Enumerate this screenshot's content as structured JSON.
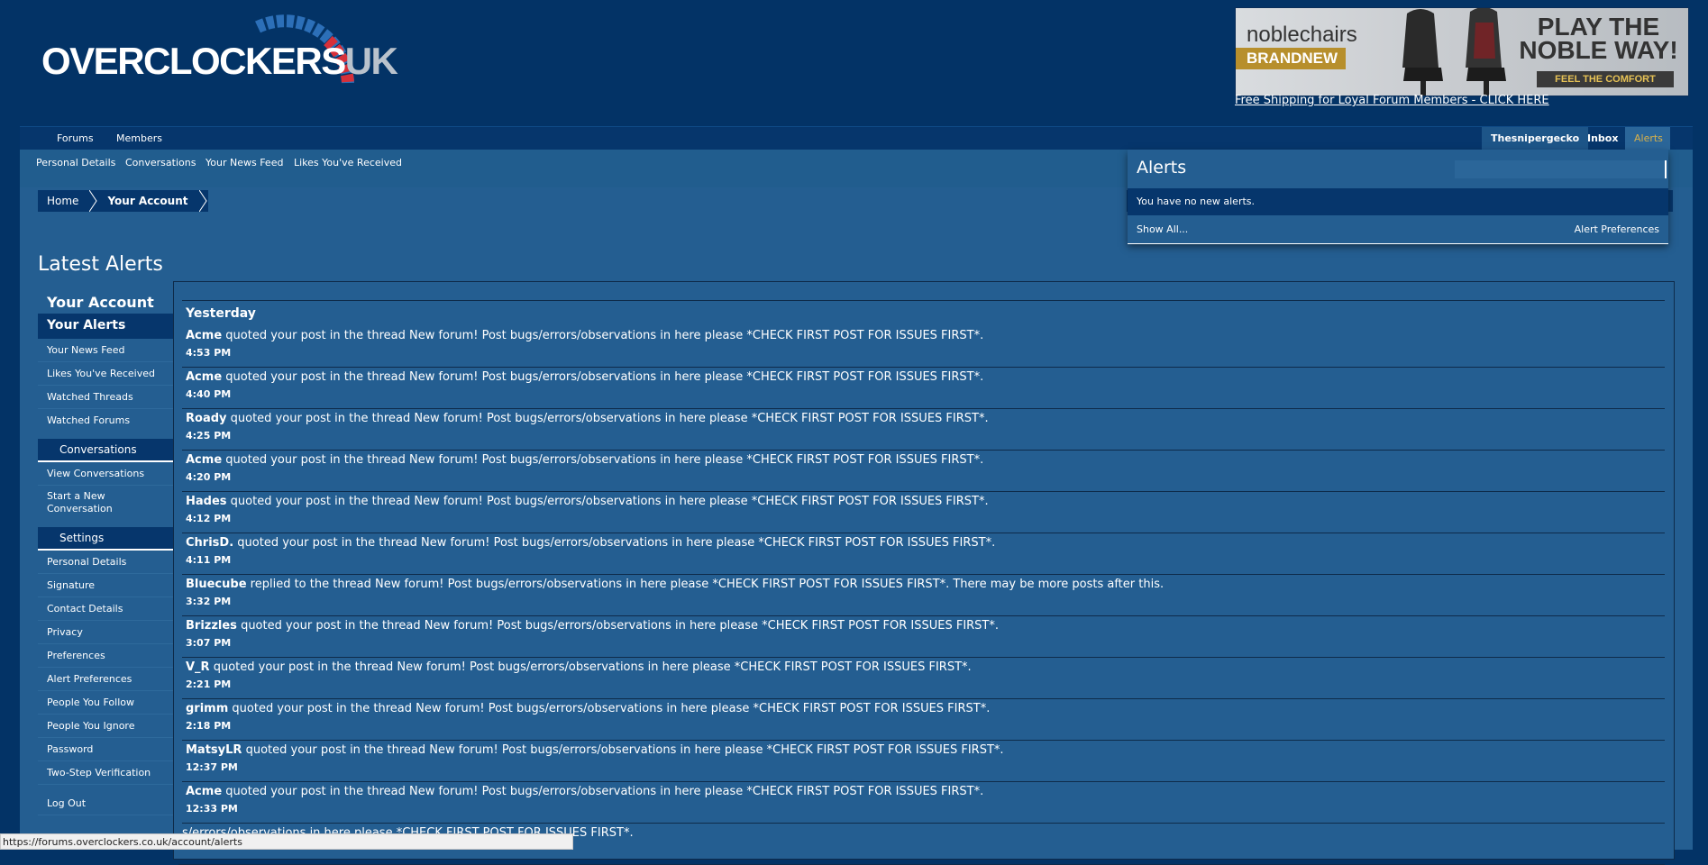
{
  "header": {
    "logo_main": "OVERCLOCKERS",
    "logo_suffix": "UK",
    "banner_brand": "noblechairs",
    "banner_badge": "BRANDNEW",
    "banner_tagline": "PLAY THE NOBLE WAY!",
    "banner_cta": "FEEL THE COMFORT",
    "shipping_link": "Free Shipping for Loyal Forum Members - CLICK HERE"
  },
  "nav": {
    "tabs": [
      "Forums",
      "Members"
    ],
    "username": "Thesnipergecko",
    "inbox": "Inbox",
    "alerts": "Alerts",
    "subnav": [
      "Personal Details",
      "Conversations",
      "Your News Feed",
      "Likes You've Received"
    ]
  },
  "breadcrumb": [
    "Home",
    "Your Account"
  ],
  "page_title": "Latest Alerts",
  "sidebar": {
    "heading": "Your Account",
    "active": "Your Alerts",
    "account_items": [
      "Your News Feed",
      "Likes You've Received",
      "Watched Threads",
      "Watched Forums"
    ],
    "conversations_title": "Conversations",
    "conversation_items": [
      "View Conversations",
      "Start a New Conversation"
    ],
    "settings_title": "Settings",
    "settings_items": [
      "Personal Details",
      "Signature",
      "Contact Details",
      "Privacy",
      "Preferences",
      "Alert Preferences",
      "People You Follow",
      "People You Ignore",
      "Password",
      "Two-Step Verification"
    ],
    "logout": "Log Out"
  },
  "alerts": {
    "day": "Yesterday",
    "items": [
      {
        "user": "Acme",
        "text": "quoted your post in the thread New forum! Post bugs/errors/observations in here please *CHECK FIRST POST FOR ISSUES FIRST*.",
        "time": "4:53 PM"
      },
      {
        "user": "Acme",
        "text": "quoted your post in the thread New forum! Post bugs/errors/observations in here please *CHECK FIRST POST FOR ISSUES FIRST*.",
        "time": "4:40 PM"
      },
      {
        "user": "Roady",
        "text": "quoted your post in the thread New forum! Post bugs/errors/observations in here please *CHECK FIRST POST FOR ISSUES FIRST*.",
        "time": "4:25 PM"
      },
      {
        "user": "Acme",
        "text": "quoted your post in the thread New forum! Post bugs/errors/observations in here please *CHECK FIRST POST FOR ISSUES FIRST*.",
        "time": "4:20 PM"
      },
      {
        "user": "Hades",
        "text": "quoted your post in the thread New forum! Post bugs/errors/observations in here please *CHECK FIRST POST FOR ISSUES FIRST*.",
        "time": "4:12 PM"
      },
      {
        "user": "ChrisD.",
        "text": "quoted your post in the thread New forum! Post bugs/errors/observations in here please *CHECK FIRST POST FOR ISSUES FIRST*.",
        "time": "4:11 PM"
      },
      {
        "user": "Bluecube",
        "text": "replied to the thread New forum! Post bugs/errors/observations in here please *CHECK FIRST POST FOR ISSUES FIRST*. There may be more posts after this.",
        "time": "3:32 PM"
      },
      {
        "user": "Brizzles",
        "text": "quoted your post in the thread New forum! Post bugs/errors/observations in here please *CHECK FIRST POST FOR ISSUES FIRST*.",
        "time": "3:07 PM"
      },
      {
        "user": "V_R",
        "text": "quoted your post in the thread New forum! Post bugs/errors/observations in here please *CHECK FIRST POST FOR ISSUES FIRST*.",
        "time": "2:21 PM"
      },
      {
        "user": "grimm",
        "text": "quoted your post in the thread New forum! Post bugs/errors/observations in here please *CHECK FIRST POST FOR ISSUES FIRST*.",
        "time": "2:18 PM"
      },
      {
        "user": "MatsyLR",
        "text": "quoted your post in the thread New forum! Post bugs/errors/observations in here please *CHECK FIRST POST FOR ISSUES FIRST*.",
        "time": "12:37 PM"
      },
      {
        "user": "Acme",
        "text": "quoted your post in the thread New forum! Post bugs/errors/observations in here please *CHECK FIRST POST FOR ISSUES FIRST*.",
        "time": "12:33 PM"
      },
      {
        "user": "",
        "text": "s/errors/observations in here please *CHECK FIRST POST FOR ISSUES FIRST*.",
        "time": ""
      }
    ]
  },
  "alerts_popup": {
    "title": "Alerts",
    "empty_message": "You have no new alerts.",
    "show_all": "Show All...",
    "preferences": "Alert Preferences"
  },
  "status_bar": "https://forums.overclockers.co.uk/account/alerts"
}
